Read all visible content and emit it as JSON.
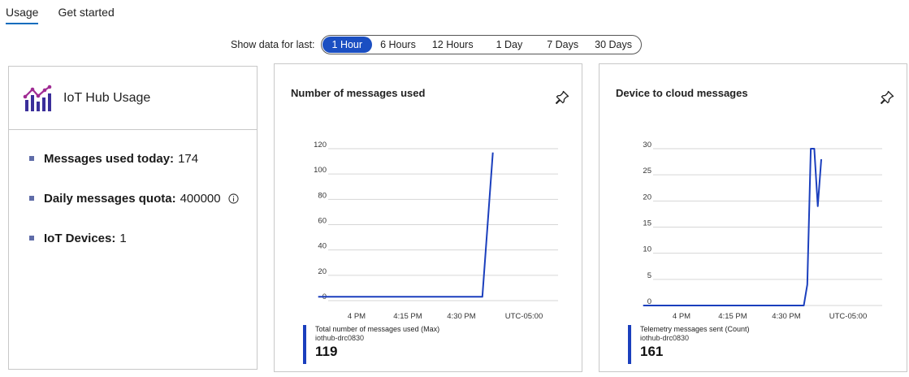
{
  "tabs": [
    {
      "label": "Usage",
      "active": true
    },
    {
      "label": "Get started",
      "active": false
    }
  ],
  "time_range": {
    "label": "Show data for last:",
    "options": [
      "1 Hour",
      "6 Hours",
      "12 Hours",
      "1 Day",
      "7 Days",
      "30 Days"
    ],
    "selected": "1 Hour"
  },
  "usage_card": {
    "title": "IoT Hub Usage",
    "items": [
      {
        "label": "Messages used today:",
        "value": "174"
      },
      {
        "label": "Daily messages quota:",
        "value": "400000",
        "info_icon": "info-icon"
      },
      {
        "label": "IoT Devices:",
        "value": "1"
      }
    ]
  },
  "charts": {
    "messages": {
      "title": "Number of messages used",
      "legend_metric": "Total number of messages used (Max)",
      "legend_resource": "iothub-drc0830",
      "legend_value": "119",
      "x_ticks": [
        "4 PM",
        "4:15 PM",
        "4:30 PM",
        "UTC-05:00"
      ],
      "y_ticks": [
        "120",
        "100",
        "80",
        "60",
        "40",
        "20",
        "0"
      ]
    },
    "d2c": {
      "title": "Device to cloud messages",
      "legend_metric": "Telemetry messages sent (Count)",
      "legend_resource": "iothub-drc0830",
      "legend_value": "161",
      "x_ticks": [
        "4 PM",
        "4:15 PM",
        "4:30 PM",
        "UTC-05:00"
      ],
      "y_ticks": [
        "30",
        "25",
        "20",
        "15",
        "10",
        "5",
        "0"
      ]
    }
  },
  "chart_data": [
    {
      "type": "line",
      "title": "Number of messages used",
      "xlabel": "",
      "ylabel": "",
      "ylim": [
        0,
        120
      ],
      "x_ticks": [
        "4 PM",
        "4:15 PM",
        "4:30 PM",
        "UTC-05:00"
      ],
      "grid": true,
      "series": [
        {
          "name": "Total number of messages used (Max)",
          "x": [
            "3:49 PM",
            "4:36 PM",
            "4:39 PM"
          ],
          "values": [
            3,
            3,
            117
          ]
        }
      ]
    },
    {
      "type": "line",
      "title": "Device to cloud messages",
      "xlabel": "",
      "ylabel": "",
      "ylim": [
        0,
        30
      ],
      "x_ticks": [
        "4 PM",
        "4:15 PM",
        "4:30 PM",
        "UTC-05:00"
      ],
      "grid": true,
      "series": [
        {
          "name": "Telemetry messages sent (Count)",
          "x": [
            "3:49 PM",
            "4:35 PM",
            "4:36 PM",
            "4:37 PM",
            "4:38 PM",
            "4:39 PM",
            "4:40 PM"
          ],
          "values": [
            0,
            0,
            4,
            30,
            30,
            19,
            28
          ]
        }
      ]
    }
  ],
  "colors": {
    "accent": "#0f6cbd",
    "pill_active": "#1b4fc2",
    "series_line": "#1b3fbd",
    "bullet": "#5f6ca8"
  }
}
